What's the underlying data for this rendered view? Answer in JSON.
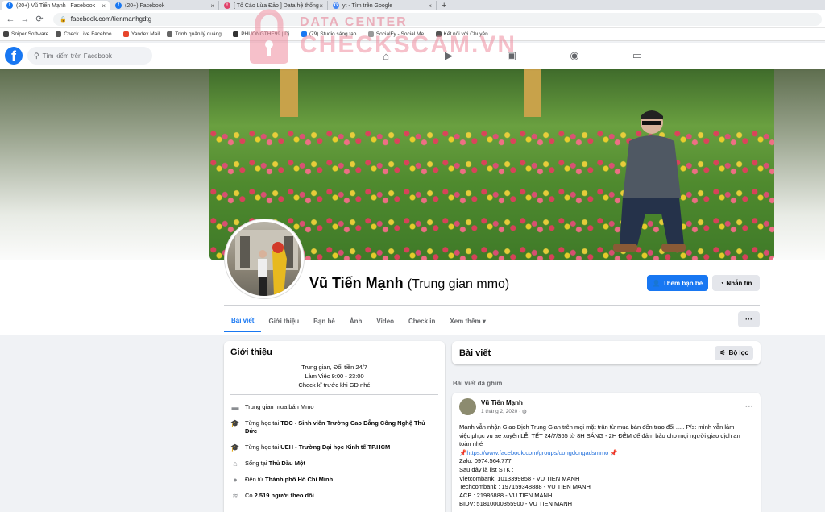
{
  "browser": {
    "tabs": [
      {
        "title": "(20+) Vũ Tiến Mạnh | Facebook",
        "icon": "facebook-icon",
        "active": true
      },
      {
        "title": "(20+) Facebook",
        "icon": "facebook-icon",
        "active": false
      },
      {
        "title": "[ Tố Cáo Lừa Đảo ] Data hệ thống",
        "icon": "checkscam-icon",
        "active": false
      },
      {
        "title": "yt - Tìm trên Google",
        "icon": "google-icon",
        "active": false
      }
    ],
    "new_tab": "+",
    "url": "facebook.com/tienmanhgdtg",
    "bookmarks": [
      {
        "label": "Sniper Software",
        "color": "#444"
      },
      {
        "label": "Check Live Faceboo...",
        "color": "#555"
      },
      {
        "label": "Yandex.Mail",
        "color": "#e6452b"
      },
      {
        "label": "Trình quản lý quảng...",
        "color": "#666"
      },
      {
        "label": "PHUONGTHE99 | Dị...",
        "color": "#333"
      },
      {
        "label": "(79) Studio sáng tạo...",
        "color": "#1877f2"
      },
      {
        "label": "SocialFy - Social Me...",
        "color": "#999"
      },
      {
        "label": "Kết nối với Chuyên...",
        "color": "#555"
      }
    ]
  },
  "fb_header": {
    "logo": "f",
    "search_placeholder": "Tìm kiếm trên Facebook"
  },
  "watermark": {
    "line1": "DATA CENTER",
    "line2": "CHECKSCAM.VN"
  },
  "profile": {
    "name": "Vũ Tiến Mạnh",
    "alt_name": "(Trung gian mmo)",
    "add_friend": "Thêm bạn bè",
    "message": "Nhắn tin",
    "more": "···",
    "tabs": [
      "Bài viết",
      "Giới thiệu",
      "Bạn bè",
      "Ảnh",
      "Video",
      "Check in",
      "Xem thêm ▾"
    ]
  },
  "intro": {
    "title": "Giới thiệu",
    "bio": [
      "Trung gian, Đối tiền 24/7",
      "Làm Việc 9:00 - 23:00",
      "Check kĩ trước khi GD nhé"
    ],
    "rows": [
      {
        "icon": "briefcase-icon",
        "glyph": "▬",
        "prefix": "Trung gian mua bán Mmo",
        "bold": ""
      },
      {
        "icon": "graduation-cap-icon",
        "glyph": "🎓",
        "prefix": "Từng học tại ",
        "bold": "TDC - Sinh viên Trường Cao Đẳng Công Nghệ Thủ Đức"
      },
      {
        "icon": "graduation-cap-icon",
        "glyph": "🎓",
        "prefix": "Từng học tại ",
        "bold": "UEH - Trường Đại học Kinh tế TP.HCM"
      },
      {
        "icon": "home-icon",
        "glyph": "⌂",
        "prefix": "Sống tại ",
        "bold": "Thủ Dầu Một"
      },
      {
        "icon": "location-pin-icon",
        "glyph": "●",
        "prefix": "Đến từ ",
        "bold": "Thành phố Hồ Chí Minh"
      },
      {
        "icon": "followers-icon",
        "glyph": "≋",
        "prefix": "Có ",
        "bold": "2.519 người theo dõi"
      }
    ]
  },
  "posts": {
    "title": "Bài viết",
    "filter": "Bộ lọc",
    "pinned_label": "Bài viết đã ghim",
    "post": {
      "author": "Vũ Tiến Mạnh",
      "date": "1 tháng 2, 2020 · ◍",
      "lines": [
        "Mạnh vẫn nhận Giao Dịch Trung Gian trên mọi mặt trận từ mua bán đến trao đổi ..... P/s: mình vẫn làm việc,phục vụ ae xuyên LỄ, TẾT 24/7/365 từ 8H SÁNG - 2H ĐÊM để đảm bảo cho mọi người giao dịch an toàn nhé",
        "📌https://www.facebook.com/groups/congdongadsmmo 📌",
        "Zalo: 0974.564.777",
        "Sau đây là list STK :",
        "Vietcombank: 1013399858 - VU TIEN MANH",
        "Techcombank : 197159348888 - VU TIEN MANH",
        "ACB : 21986888 - VU TIEN MANH",
        "BIDV: 51810000355900 - VU TIEN MANH"
      ]
    }
  }
}
